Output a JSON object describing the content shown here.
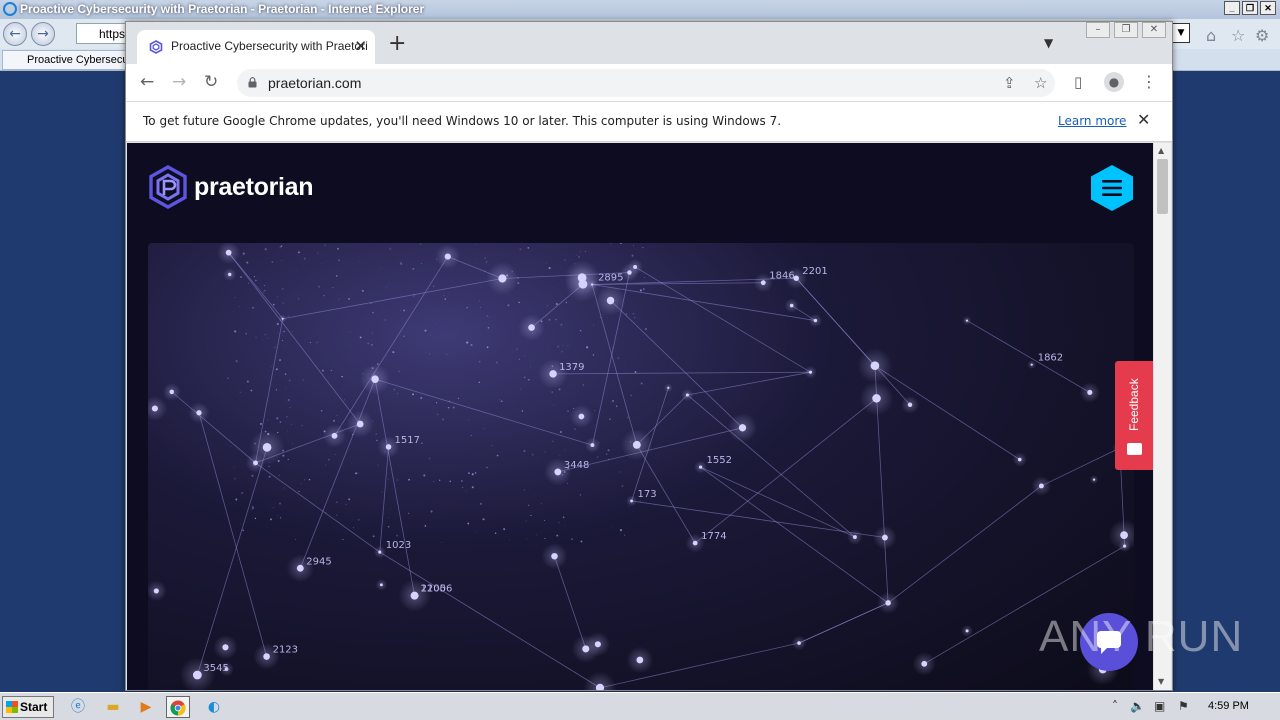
{
  "ie": {
    "title": "Proactive Cybersecurity with Praetorian - Praetorian - Internet Explorer",
    "address": "https",
    "tab_title": "Proactive Cybersecu"
  },
  "chrome": {
    "tab_title": "Proactive Cybersecurity with Praetori",
    "url": "praetorian.com",
    "infobar": {
      "message": "To get future Google Chrome updates, you'll need Windows 10 or later. This computer is using Windows 7.",
      "link": "Learn more"
    }
  },
  "page": {
    "brand": "praetorian",
    "feedback_label": "Feedback",
    "accent_color": "#00c2ff",
    "feedback_color": "#e43b4d",
    "hero_labels": [
      "2201",
      "173",
      "2123",
      "1774",
      "1552",
      "1379",
      "2945",
      "3545",
      "1023",
      "11006",
      "1862",
      "2895",
      "3448",
      "1846",
      "1517",
      "2205"
    ]
  },
  "watermark": "ANY RUN",
  "taskbar": {
    "start_label": "Start",
    "clock": "4:59 PM"
  },
  "icons": [
    "ie-icon",
    "back-icon",
    "forward-icon",
    "reload-icon",
    "lock-icon",
    "share-icon",
    "star-icon",
    "sidepanel-icon",
    "profile-icon",
    "kebab-icon",
    "close-icon",
    "menu-icon",
    "chat-icon"
  ]
}
